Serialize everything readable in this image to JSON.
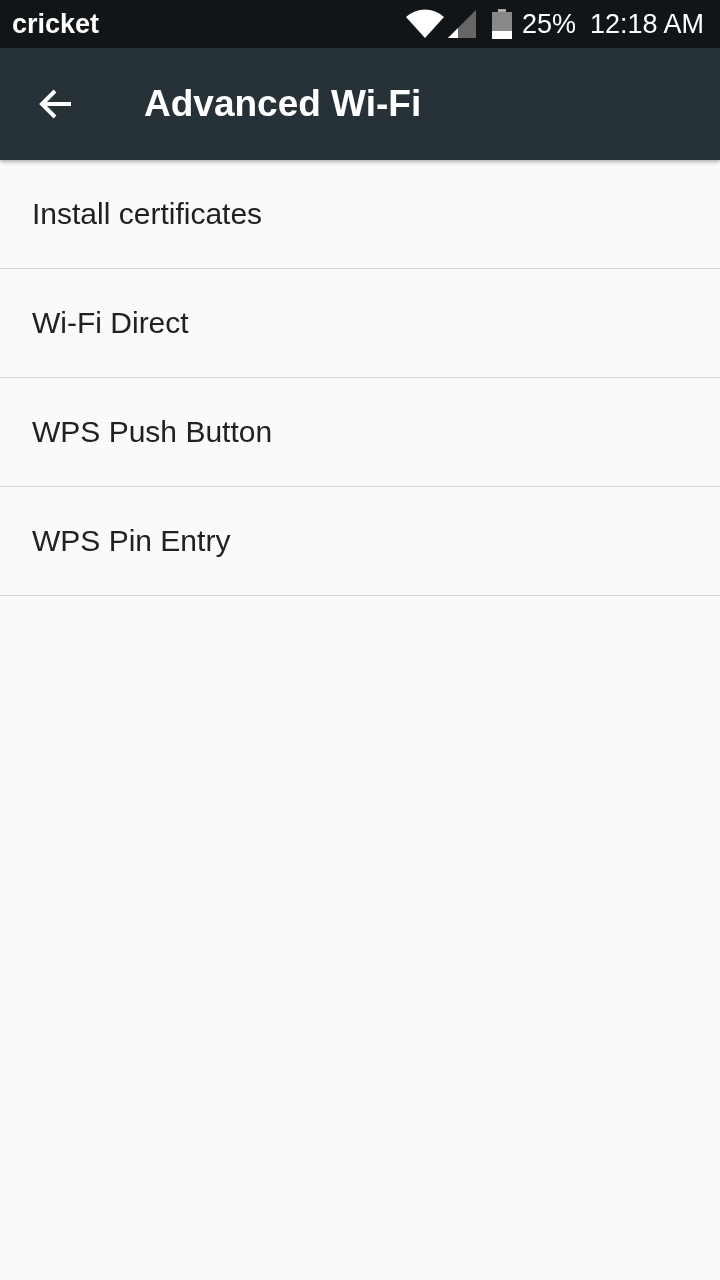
{
  "status_bar": {
    "carrier": "cricket",
    "battery": "25%",
    "time": "12:18 AM"
  },
  "app_bar": {
    "title": "Advanced Wi-Fi"
  },
  "items": [
    {
      "label": "Install certificates"
    },
    {
      "label": "Wi-Fi Direct"
    },
    {
      "label": "WPS Push Button"
    },
    {
      "label": "WPS Pin Entry"
    }
  ]
}
